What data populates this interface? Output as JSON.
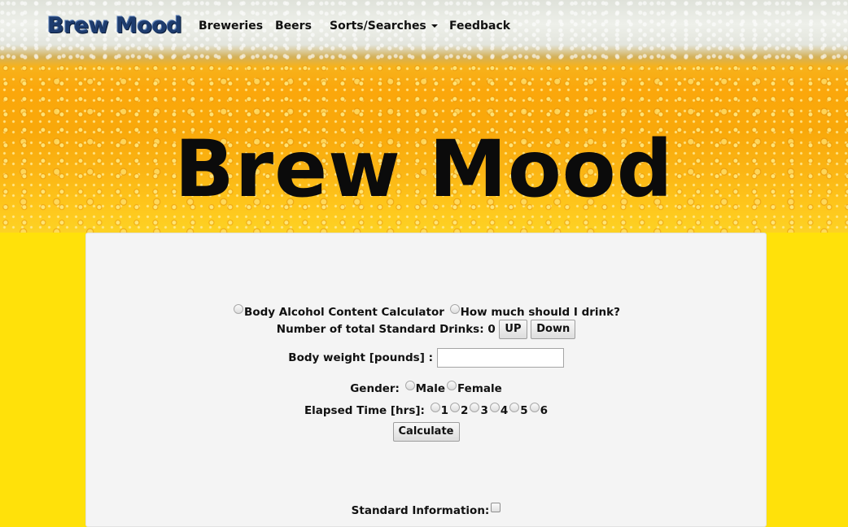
{
  "navbar": {
    "brand": "Brew Mood",
    "links": [
      "Breweries",
      "Beers",
      "Sorts/Searches",
      "Feedback"
    ]
  },
  "hero": {
    "title": "Brew Mood"
  },
  "form": {
    "mode_options": [
      "Body Alcohol Content Calculator",
      "How much should I drink?"
    ],
    "drinks": {
      "label": "Number of total Standard Drinks:",
      "value": "0",
      "up_label": "UP",
      "down_label": "Down"
    },
    "weight": {
      "label": "Body weight [pounds] :",
      "value": ""
    },
    "gender": {
      "label": "Gender:",
      "options": [
        "Male",
        "Female"
      ]
    },
    "elapsed": {
      "label": "Elapsed Time [hrs]:",
      "options": [
        "1",
        "2",
        "3",
        "4",
        "5",
        "6"
      ]
    },
    "calculate_label": "Calculate",
    "standard_info_label": "Standard Information:"
  },
  "colors": {
    "page_bg": "#ffe10a",
    "panel_bg": "#f4f4f4",
    "brand": "#1e3c6e"
  }
}
